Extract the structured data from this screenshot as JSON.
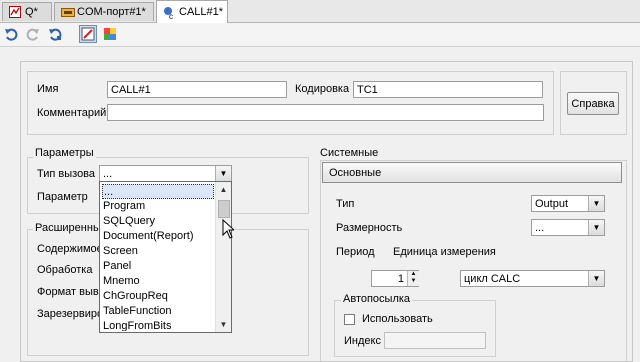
{
  "tabs": [
    {
      "label": "Q*"
    },
    {
      "label": "COM-порт#1*"
    },
    {
      "label": "CALL#1*"
    }
  ],
  "header": {
    "name_label": "Имя",
    "name_value": "CALL#1",
    "code_label": "Кодировка",
    "code_value": "TC1",
    "comment_label": "Комментарий",
    "comment_value": "",
    "help_button": "Справка"
  },
  "params": {
    "group_title": "Параметры",
    "call_type_label": "Тип вызова",
    "call_type_value": "...",
    "param_label": "Параметр"
  },
  "call_type_options": [
    "...",
    "Program",
    "SQLQuery",
    "Document(Report)",
    "Screen",
    "Panel",
    "Mnemo",
    "ChGroupReq",
    "TableFunction",
    "LongFromBits"
  ],
  "advanced": {
    "group_title": "Расширенные",
    "content_label": "Содержимое",
    "processing_label": "Обработка",
    "format_label": "Формат выво",
    "reserved_label": "Зарезервиро"
  },
  "system": {
    "group_title": "Системные",
    "main_tab": "Основные",
    "type_label": "Тип",
    "type_value": "Output",
    "dimension_label": "Размерность",
    "dimension_value": "...",
    "period_label": "Период",
    "unit_label": "Единица измерения",
    "period_value": "1",
    "unit_value": "цикл CALC",
    "autosend_title": "Автопосылка",
    "use_label": "Использовать",
    "index_label": "Индекс",
    "index_value": ""
  }
}
